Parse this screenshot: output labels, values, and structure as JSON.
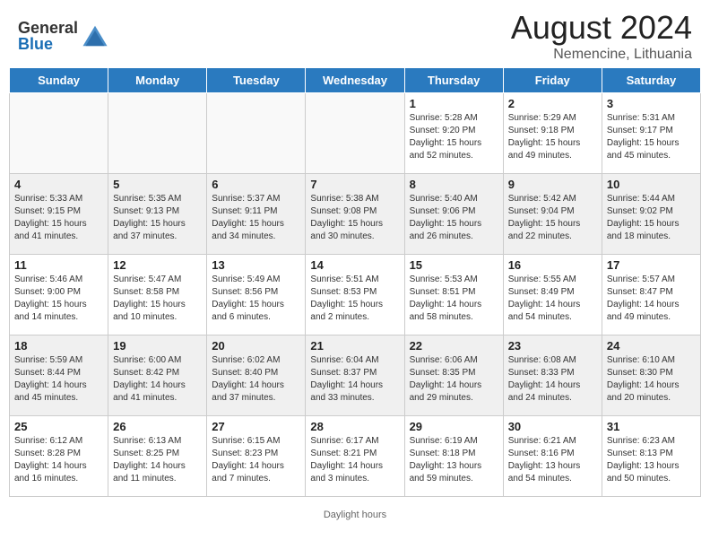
{
  "header": {
    "logo_general": "General",
    "logo_blue": "Blue",
    "main_title": "August 2024",
    "sub_title": "Nemencine, Lithuania"
  },
  "days_of_week": [
    "Sunday",
    "Monday",
    "Tuesday",
    "Wednesday",
    "Thursday",
    "Friday",
    "Saturday"
  ],
  "weeks": [
    [
      {
        "day": "",
        "info": ""
      },
      {
        "day": "",
        "info": ""
      },
      {
        "day": "",
        "info": ""
      },
      {
        "day": "",
        "info": ""
      },
      {
        "day": "1",
        "info": "Sunrise: 5:28 AM\nSunset: 9:20 PM\nDaylight: 15 hours\nand 52 minutes."
      },
      {
        "day": "2",
        "info": "Sunrise: 5:29 AM\nSunset: 9:18 PM\nDaylight: 15 hours\nand 49 minutes."
      },
      {
        "day": "3",
        "info": "Sunrise: 5:31 AM\nSunset: 9:17 PM\nDaylight: 15 hours\nand 45 minutes."
      }
    ],
    [
      {
        "day": "4",
        "info": "Sunrise: 5:33 AM\nSunset: 9:15 PM\nDaylight: 15 hours\nand 41 minutes."
      },
      {
        "day": "5",
        "info": "Sunrise: 5:35 AM\nSunset: 9:13 PM\nDaylight: 15 hours\nand 37 minutes."
      },
      {
        "day": "6",
        "info": "Sunrise: 5:37 AM\nSunset: 9:11 PM\nDaylight: 15 hours\nand 34 minutes."
      },
      {
        "day": "7",
        "info": "Sunrise: 5:38 AM\nSunset: 9:08 PM\nDaylight: 15 hours\nand 30 minutes."
      },
      {
        "day": "8",
        "info": "Sunrise: 5:40 AM\nSunset: 9:06 PM\nDaylight: 15 hours\nand 26 minutes."
      },
      {
        "day": "9",
        "info": "Sunrise: 5:42 AM\nSunset: 9:04 PM\nDaylight: 15 hours\nand 22 minutes."
      },
      {
        "day": "10",
        "info": "Sunrise: 5:44 AM\nSunset: 9:02 PM\nDaylight: 15 hours\nand 18 minutes."
      }
    ],
    [
      {
        "day": "11",
        "info": "Sunrise: 5:46 AM\nSunset: 9:00 PM\nDaylight: 15 hours\nand 14 minutes."
      },
      {
        "day": "12",
        "info": "Sunrise: 5:47 AM\nSunset: 8:58 PM\nDaylight: 15 hours\nand 10 minutes."
      },
      {
        "day": "13",
        "info": "Sunrise: 5:49 AM\nSunset: 8:56 PM\nDaylight: 15 hours\nand 6 minutes."
      },
      {
        "day": "14",
        "info": "Sunrise: 5:51 AM\nSunset: 8:53 PM\nDaylight: 15 hours\nand 2 minutes."
      },
      {
        "day": "15",
        "info": "Sunrise: 5:53 AM\nSunset: 8:51 PM\nDaylight: 14 hours\nand 58 minutes."
      },
      {
        "day": "16",
        "info": "Sunrise: 5:55 AM\nSunset: 8:49 PM\nDaylight: 14 hours\nand 54 minutes."
      },
      {
        "day": "17",
        "info": "Sunrise: 5:57 AM\nSunset: 8:47 PM\nDaylight: 14 hours\nand 49 minutes."
      }
    ],
    [
      {
        "day": "18",
        "info": "Sunrise: 5:59 AM\nSunset: 8:44 PM\nDaylight: 14 hours\nand 45 minutes."
      },
      {
        "day": "19",
        "info": "Sunrise: 6:00 AM\nSunset: 8:42 PM\nDaylight: 14 hours\nand 41 minutes."
      },
      {
        "day": "20",
        "info": "Sunrise: 6:02 AM\nSunset: 8:40 PM\nDaylight: 14 hours\nand 37 minutes."
      },
      {
        "day": "21",
        "info": "Sunrise: 6:04 AM\nSunset: 8:37 PM\nDaylight: 14 hours\nand 33 minutes."
      },
      {
        "day": "22",
        "info": "Sunrise: 6:06 AM\nSunset: 8:35 PM\nDaylight: 14 hours\nand 29 minutes."
      },
      {
        "day": "23",
        "info": "Sunrise: 6:08 AM\nSunset: 8:33 PM\nDaylight: 14 hours\nand 24 minutes."
      },
      {
        "day": "24",
        "info": "Sunrise: 6:10 AM\nSunset: 8:30 PM\nDaylight: 14 hours\nand 20 minutes."
      }
    ],
    [
      {
        "day": "25",
        "info": "Sunrise: 6:12 AM\nSunset: 8:28 PM\nDaylight: 14 hours\nand 16 minutes."
      },
      {
        "day": "26",
        "info": "Sunrise: 6:13 AM\nSunset: 8:25 PM\nDaylight: 14 hours\nand 11 minutes."
      },
      {
        "day": "27",
        "info": "Sunrise: 6:15 AM\nSunset: 8:23 PM\nDaylight: 14 hours\nand 7 minutes."
      },
      {
        "day": "28",
        "info": "Sunrise: 6:17 AM\nSunset: 8:21 PM\nDaylight: 14 hours\nand 3 minutes."
      },
      {
        "day": "29",
        "info": "Sunrise: 6:19 AM\nSunset: 8:18 PM\nDaylight: 13 hours\nand 59 minutes."
      },
      {
        "day": "30",
        "info": "Sunrise: 6:21 AM\nSunset: 8:16 PM\nDaylight: 13 hours\nand 54 minutes."
      },
      {
        "day": "31",
        "info": "Sunrise: 6:23 AM\nSunset: 8:13 PM\nDaylight: 13 hours\nand 50 minutes."
      }
    ]
  ],
  "footer": {
    "daylight_hours": "Daylight hours"
  }
}
